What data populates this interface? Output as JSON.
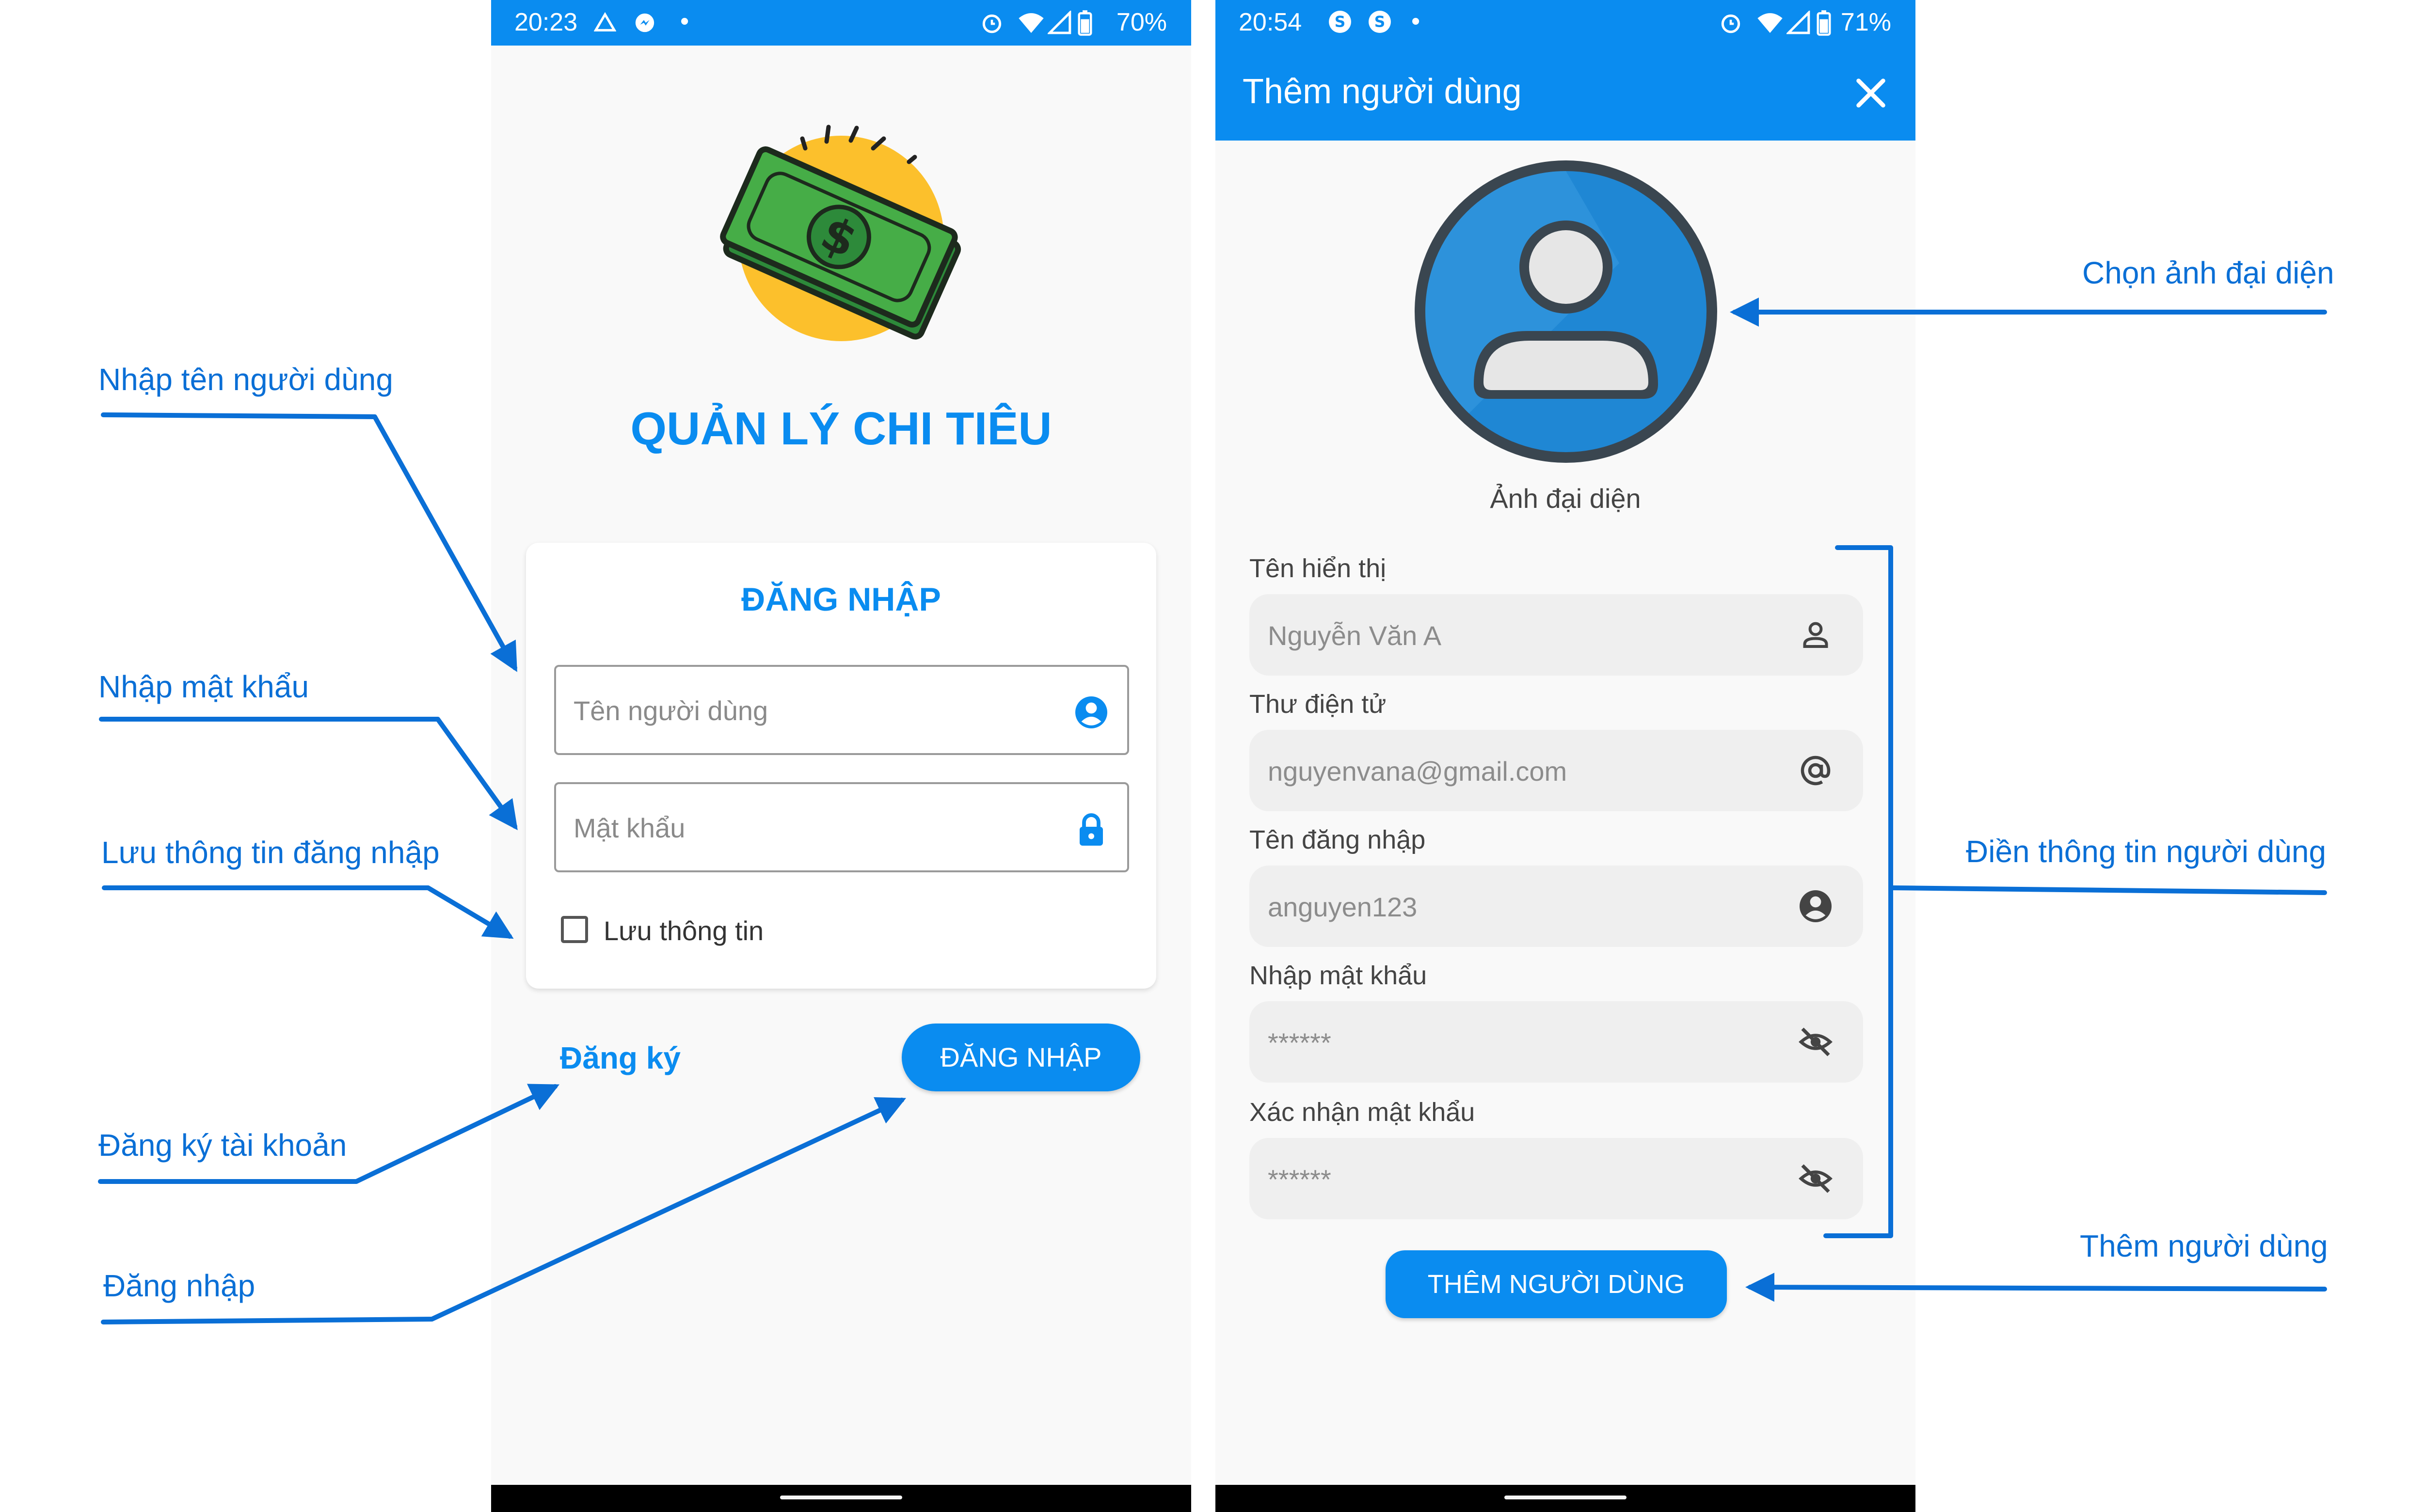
{
  "colors": {
    "accent": "#0a8cf0",
    "annotation": "#0a6fd6",
    "field_bg": "#efefef",
    "page_bg": "#f9f9f9"
  },
  "login_screen": {
    "status_time": "20:23",
    "status_left_icons": [
      "cast-icon",
      "messenger-icon",
      "dot"
    ],
    "status_battery": "70%",
    "app_title": "QUẢN LÝ CHI TIÊU",
    "logo": "money-logo",
    "card_title": "ĐĂNG NHẬP",
    "username_placeholder": "Tên người dùng",
    "username_icon": "account-circle-icon",
    "password_placeholder": "Mật khẩu",
    "password_icon": "lock-icon",
    "remember_label": "Lưu thông tin",
    "remember_checked": false,
    "register_label": "Đăng ký",
    "login_button": "ĐĂNG NHẬP"
  },
  "add_user_screen": {
    "status_time": "20:54",
    "status_left_icons": [
      "skype-icon",
      "skype-icon",
      "dot"
    ],
    "status_battery": "71%",
    "title": "Thêm người dùng",
    "close_icon": "close-icon",
    "avatar_icon": "person-avatar-icon",
    "avatar_label": "Ảnh đại diện",
    "fields": [
      {
        "label": "Tên hiển thị",
        "placeholder": "Nguyễn Văn A",
        "icon": "person-outline-icon"
      },
      {
        "label": "Thư điện tử",
        "placeholder": "nguyenvana@gmail.com",
        "icon": "at-sign-icon"
      },
      {
        "label": "Tên đăng nhập",
        "placeholder": "anguyen123",
        "icon": "account-circle-icon"
      },
      {
        "label": "Nhập mật khẩu",
        "placeholder": "******",
        "icon": "eye-off-icon"
      },
      {
        "label": "Xác nhận mật khẩu",
        "placeholder": "******",
        "icon": "eye-off-icon"
      }
    ],
    "submit_button": "THÊM NGƯỜI DÙNG"
  },
  "annotations": {
    "enter_username": "Nhập tên người dùng",
    "enter_password": "Nhập mật khẩu",
    "save_login": "Lưu thông tin đăng nhập",
    "register_account": "Đăng ký tài khoản",
    "login": "Đăng nhập",
    "choose_avatar": "Chọn ảnh đại diện",
    "fill_user_info": "Điền thông tin người dùng",
    "add_user": "Thêm người dùng"
  }
}
